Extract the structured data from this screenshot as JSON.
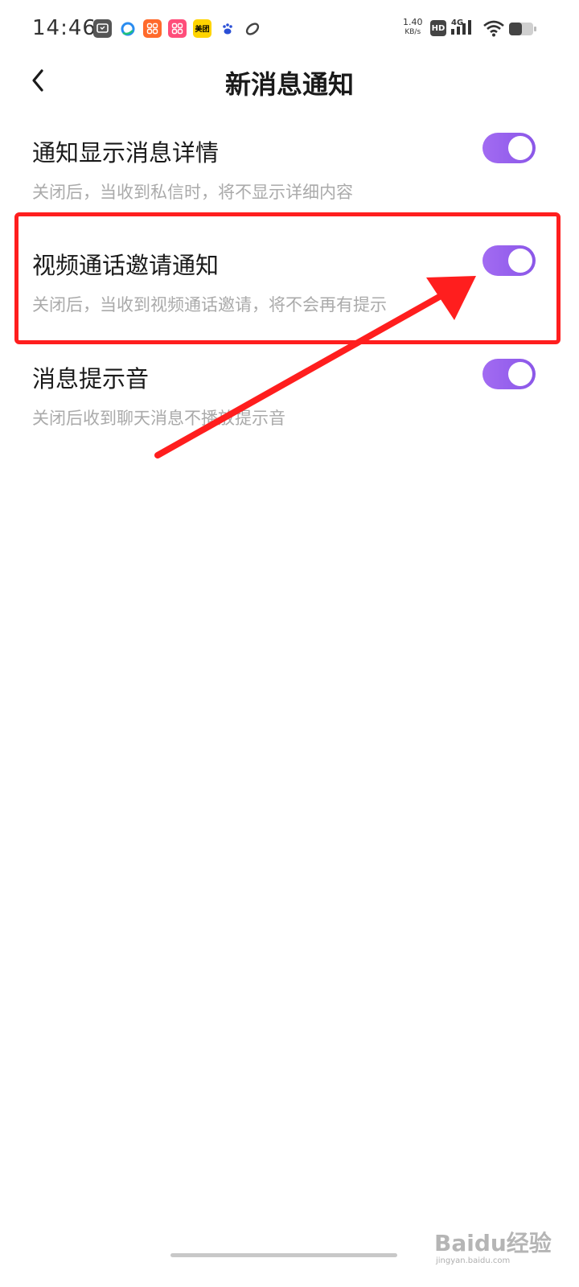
{
  "status_bar": {
    "time": "14:46",
    "net_speed_value": "1.40",
    "net_speed_unit": "KB/s",
    "hd_label": "HD",
    "network_type": "4G",
    "app_icons": [
      {
        "name": "tv-app-icon"
      },
      {
        "name": "browser-app-icon"
      },
      {
        "name": "app-icon-orange"
      },
      {
        "name": "app-icon-pink"
      },
      {
        "name": "meituan-app-icon",
        "label": "美团"
      },
      {
        "name": "baidu-app-icon"
      },
      {
        "name": "app-icon-leaf"
      }
    ]
  },
  "header": {
    "title": "新消息通知"
  },
  "settings": [
    {
      "title": "通知显示消息详情",
      "description": "关闭后，当收到私信时，将不显示详细内容",
      "enabled": true
    },
    {
      "title": "视频通话邀请通知",
      "description": "关闭后，当收到视频通话邀请，将不会再有提示",
      "enabled": true
    },
    {
      "title": "消息提示音",
      "description": "关闭后收到聊天消息不播放提示音",
      "enabled": true
    }
  ],
  "colors": {
    "toggle_on": "#9b63ef",
    "highlight": "#ff1e1e"
  },
  "watermark": {
    "main": "Baidu经验",
    "sub": "jingyan.baidu.com"
  }
}
